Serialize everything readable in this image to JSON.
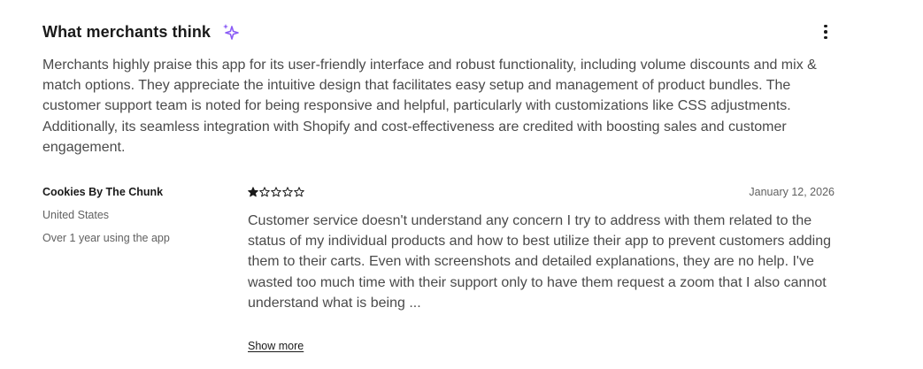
{
  "summary": {
    "title": "What merchants think",
    "icon": "sparkle-icon",
    "menu_icon": "more-vertical-icon",
    "text": "Merchants highly praise this app for its user-friendly interface and robust functionality, including volume discounts and mix & match options. They appreciate the intuitive design that facilitates easy setup and management of product bundles. The customer support team is noted for being responsive and helpful, particularly with customizations like CSS adjustments. Additionally, its seamless integration with Shopify and cost-effectiveness are credited with boosting sales and customer engagement."
  },
  "review": {
    "reviewer_name": "Cookies By The Chunk",
    "country": "United States",
    "usage": "Over 1 year using the app",
    "rating": 1,
    "max_rating": 5,
    "date": "January 12, 2026",
    "text": "Customer service doesn't understand any concern I try to address with them related to the status of my individual products and how to best utilize their app to prevent customers adding them to their carts. Even with screenshots and detailed explanations, they are no help. I've wasted too much time with their support only to have them request a zoom that I also cannot understand what is being ...",
    "show_more_label": "Show more"
  },
  "colors": {
    "sparkle": "#8a5cf6",
    "text_primary": "#1a1a1a",
    "text_body": "#4a4a4a",
    "text_muted": "#616161"
  }
}
